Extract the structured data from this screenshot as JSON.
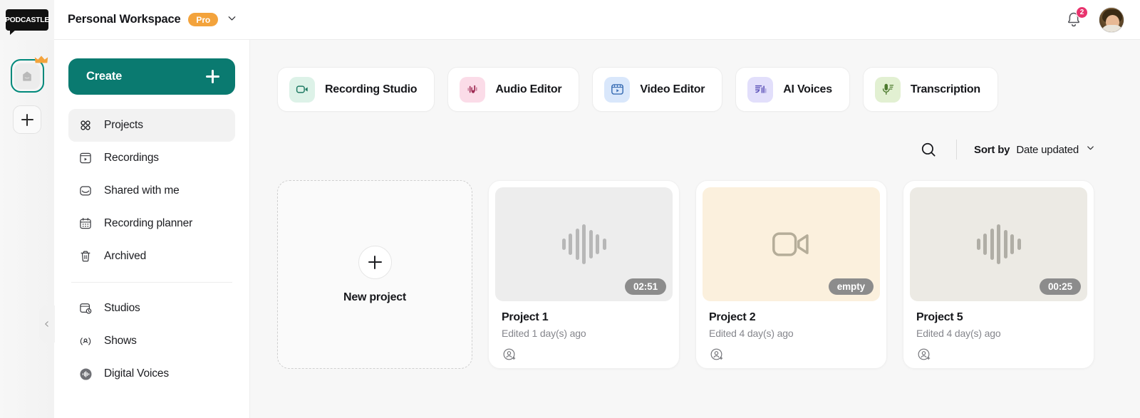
{
  "brand": {
    "logo_text": "PODCASTLE",
    "accent": "#0a7a70",
    "pro_color": "#f3a33c",
    "badge_color": "#e8336d"
  },
  "topbar": {
    "workspace_name": "Personal Workspace",
    "plan_badge": "Pro",
    "workspace_chevron_icon": "chevron-down-icon",
    "notifications_icon": "bell-icon",
    "notifications_count": "2",
    "avatar_icon": "user-avatar"
  },
  "rail": {
    "workspace_avatar_icon": "workspace-avatar-icon",
    "crown_icon": "crown-icon",
    "add_workspace_icon": "plus-icon"
  },
  "sidebar": {
    "create_label": "Create",
    "create_icon": "plus-icon",
    "collapse_icon": "chevron-left-icon",
    "group1": [
      {
        "label": "Projects",
        "icon": "grid-icon",
        "active": true
      },
      {
        "label": "Recordings",
        "icon": "recordings-icon",
        "active": false
      },
      {
        "label": "Shared with me",
        "icon": "inbox-icon",
        "active": false
      },
      {
        "label": "Recording planner",
        "icon": "calendar-icon",
        "active": false
      },
      {
        "label": "Archived",
        "icon": "trash-icon",
        "active": false
      }
    ],
    "group2": [
      {
        "label": "Studios",
        "icon": "studios-icon"
      },
      {
        "label": "Shows",
        "icon": "shows-icon"
      },
      {
        "label": "Digital Voices",
        "icon": "digital-voices-icon"
      }
    ]
  },
  "tools": [
    {
      "label": "Recording Studio",
      "icon": "camcorder-icon",
      "tile_bg": "#ddf2e8",
      "icon_color": "#1f7a63"
    },
    {
      "label": "Audio Editor",
      "icon": "audio-waveform-icon",
      "tile_bg": "#fbdce8",
      "icon_color": "#9e2a53"
    },
    {
      "label": "Video Editor",
      "icon": "video-play-icon",
      "tile_bg": "#d9e7fb",
      "icon_color": "#3c6fb5"
    },
    {
      "label": "AI Voices",
      "icon": "ai-voices-icon",
      "tile_bg": "#e2dffb",
      "icon_color": "#5b51b8"
    },
    {
      "label": "Transcription",
      "icon": "microphone-icon",
      "tile_bg": "#e2f0d2",
      "icon_color": "#4d7a2f"
    }
  ],
  "toolbar": {
    "search_icon": "search-icon",
    "sort_by_label": "Sort by",
    "sort_value": "Date updated",
    "sort_chevron_icon": "chevron-down-icon"
  },
  "new_project": {
    "label": "New project",
    "icon": "plus-icon"
  },
  "projects": [
    {
      "title": "Project 1",
      "edited": "Edited 1 day(s) ago",
      "pill": "02:51",
      "thumb_type": "waveform",
      "thumb_bg": "#ededed",
      "icon_color": "#b7b7b7",
      "share_icon": "add-person-icon"
    },
    {
      "title": "Project 2",
      "edited": "Edited 4 day(s) ago",
      "pill": "empty",
      "thumb_type": "camcorder",
      "thumb_bg": "#fbf0dd",
      "icon_color": "#b5ad99",
      "share_icon": "add-person-icon"
    },
    {
      "title": "Project 5",
      "edited": "Edited 4 day(s) ago",
      "pill": "00:25",
      "thumb_type": "waveform",
      "thumb_bg": "#eceae4",
      "icon_color": "#b0aea6",
      "share_icon": "add-person-icon"
    }
  ]
}
